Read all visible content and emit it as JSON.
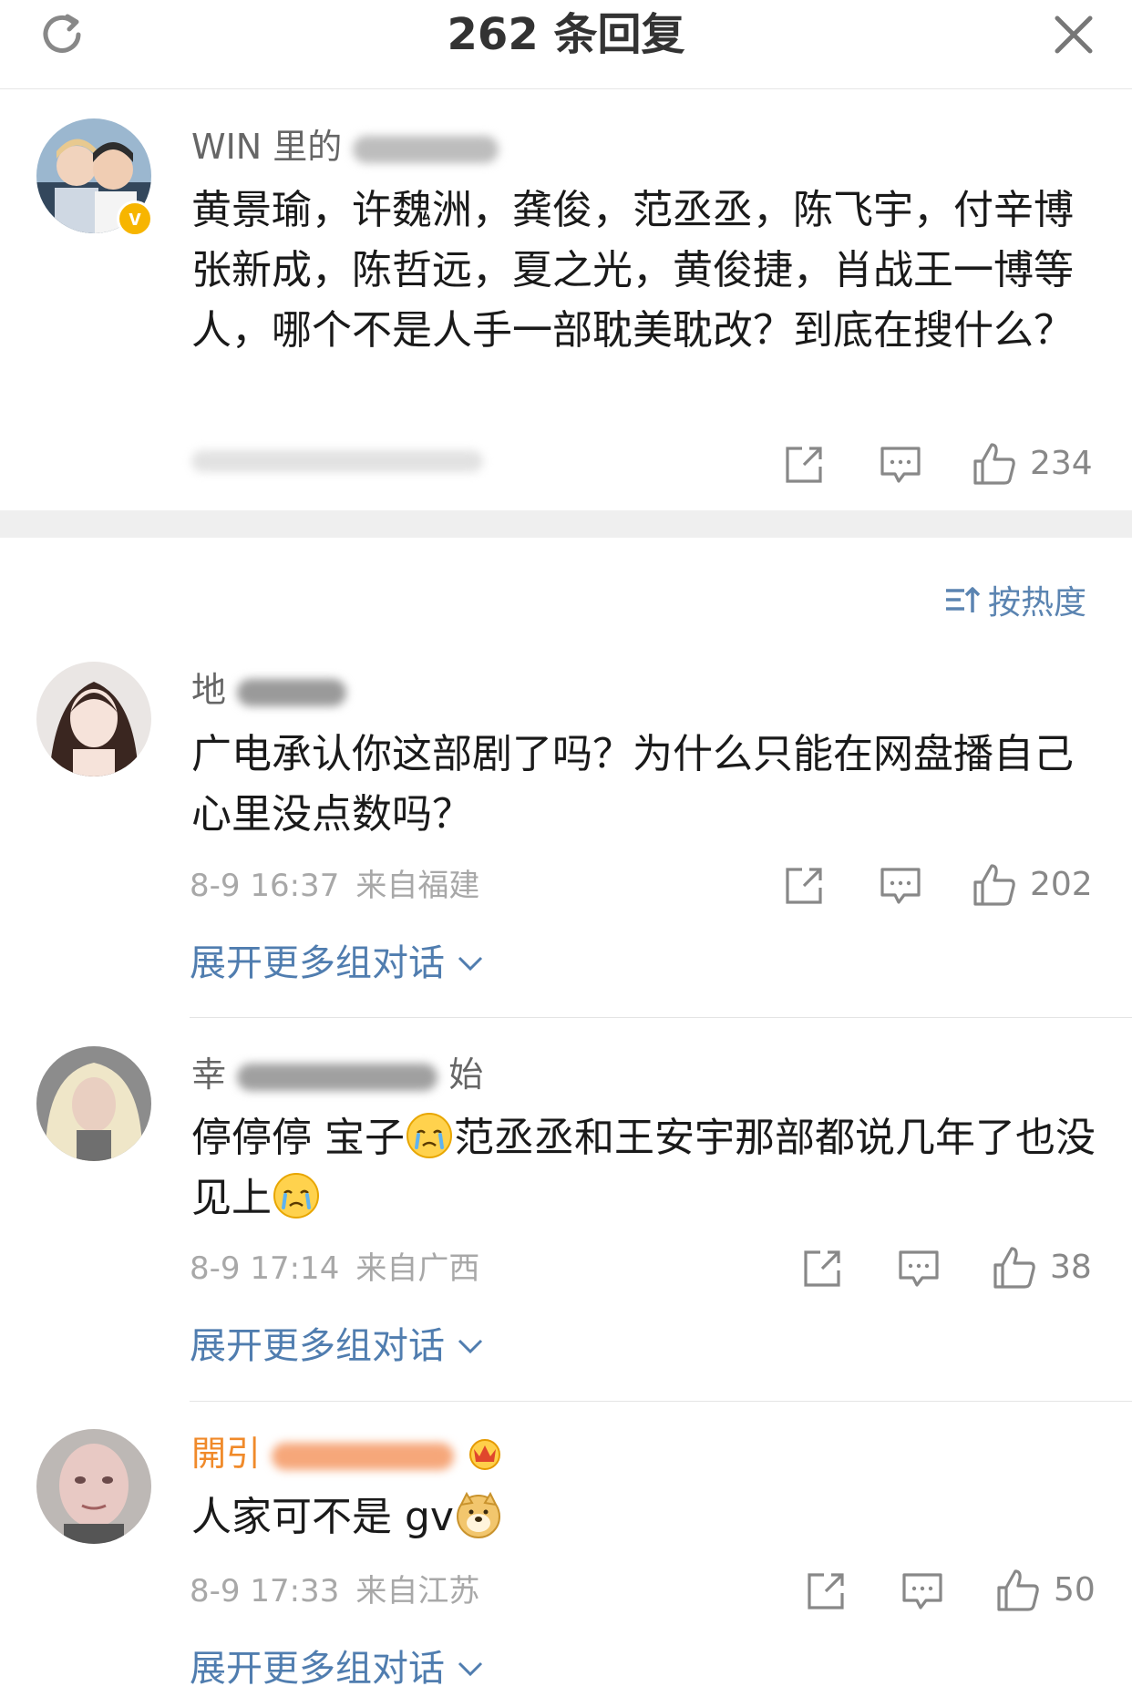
{
  "header": {
    "title": "262 条回复"
  },
  "sort": {
    "label": "按热度"
  },
  "main_comment": {
    "username": "WIN 里的",
    "text": "黄景瑜，许魏洲，龚俊，范丞丞，陈飞宇，付辛博张新成，陈哲远，夏之光，黄俊捷，肖战王一博等人，哪个不是人手一部耽美耽改？到底在搜什么？",
    "verified_badge": "v",
    "likes": "234"
  },
  "replies": [
    {
      "username": "地",
      "text": "广电承认你这部剧了吗？为什么只能在网盘播自己心里没点数吗？",
      "time": "8-9 16:37",
      "source": "来自福建",
      "likes": "202",
      "expand_label": "展开更多组对话"
    },
    {
      "username": "幸",
      "username_tail": "始",
      "text_a": "停停停 宝子",
      "text_b": "范丞丞和王安宇那部都说几年了也没见上",
      "time": "8-9 17:14",
      "source": "来自广西",
      "likes": "38",
      "expand_label": "展开更多组对话"
    },
    {
      "username": "開引",
      "text": "人家可不是 gv",
      "time": "8-9 17:33",
      "source": "来自江苏",
      "likes": "50",
      "expand_label": "展开更多组对话"
    }
  ],
  "icons": [
    "refresh-icon",
    "close-icon",
    "share-icon",
    "comment-icon",
    "like-icon",
    "sort-icon",
    "chevron-down-icon",
    "crying-emoji",
    "doge-emoji",
    "crown-badge-icon"
  ],
  "colors": {
    "link": "#507daf",
    "sort": "#5b84b1",
    "vip_name": "#f08a2a",
    "badge": "#f7b500",
    "meta": "#a8a8a8"
  }
}
